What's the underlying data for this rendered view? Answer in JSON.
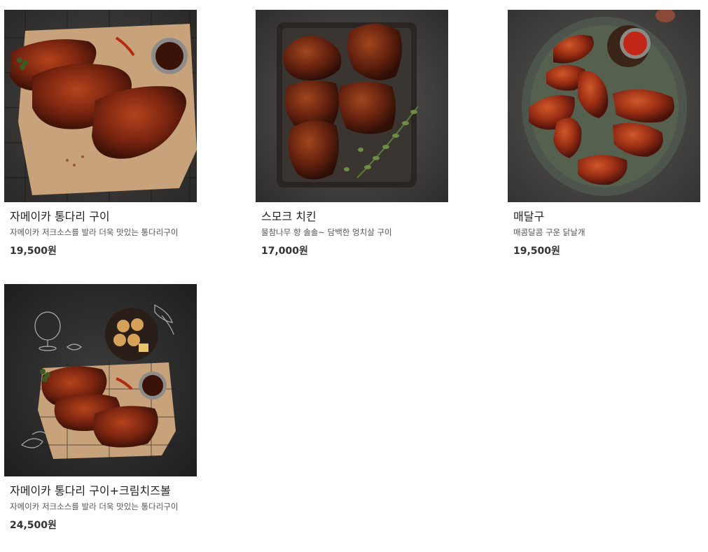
{
  "products": [
    {
      "name": "자메이카 통다리 구이",
      "description": "자메이카 저크소스를 발라 더욱 맛있는 통다리구이",
      "price": "19,500원",
      "image_icon": "roast-chicken-legs-photo"
    },
    {
      "name": "스모크 치킨",
      "description": "물참나무 향 솔솔~ 담백한 엉치살 구이",
      "price": "17,000원",
      "image_icon": "smoked-chicken-photo"
    },
    {
      "name": "매달구",
      "description": "매콤달콤 구운 닭날개",
      "price": "19,500원",
      "image_icon": "chicken-wings-photo"
    },
    {
      "name": "자메이카 통다리 구이+크림치즈볼",
      "description": "자메이카 저크소스를 발라 더욱 맛있는 통다리구이",
      "price": "24,500원",
      "image_icon": "roast-chicken-cheese-balls-photo"
    }
  ]
}
